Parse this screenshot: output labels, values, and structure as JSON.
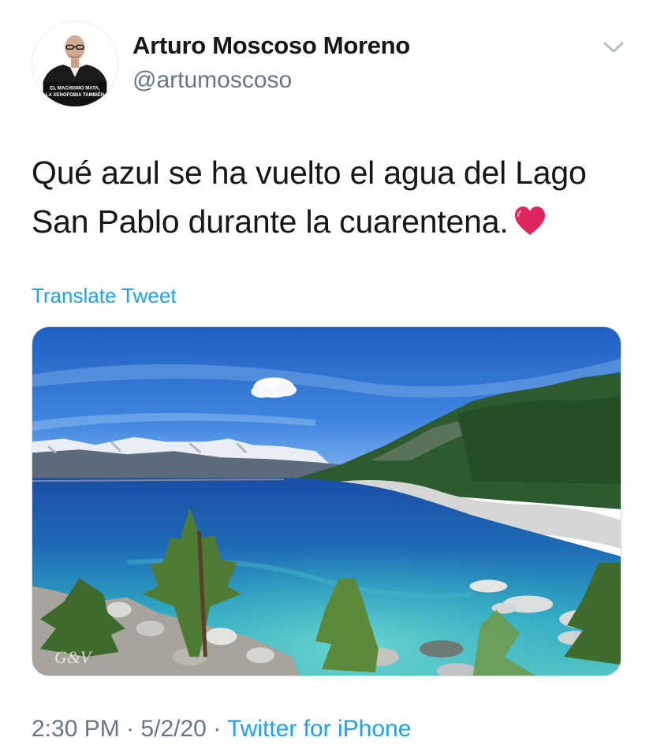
{
  "tweet": {
    "author_name": "Arturo Moscoso Moreno",
    "author_handle": "@artumoscoso",
    "text": "Qué azul se ha vuelto el agua del Lago San Pablo durante la cuarentena.",
    "translate_label": "Translate Tweet",
    "time": "2:30 PM",
    "separator": "·",
    "date": "5/2/20",
    "source": "Twitter for iPhone"
  },
  "avatar": {
    "caption_line1": "EL MACHISMO MATA,",
    "caption_line2": "LA XENOFOBIA TAMBIÉN"
  },
  "media": {
    "watermark": "G&V"
  },
  "icons": {
    "menu": "chevron-down-icon",
    "emoji": "red-heart-icon"
  },
  "colors": {
    "text": "#14171a",
    "secondary": "#657786",
    "link": "#1da1f2",
    "heart": "#e0245e"
  }
}
